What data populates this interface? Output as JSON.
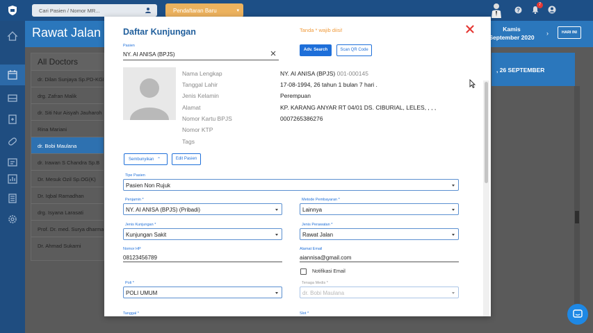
{
  "topbar": {
    "search_placeholder": "Cari Pasien / Nomor MR...",
    "register_button": "Pendaftaran Baru",
    "notification_count": "7"
  },
  "page": {
    "title": "Rawat Jalan",
    "date_line1": "Kamis",
    "date_line2": "September 2020",
    "today_button": "HARI INI",
    "schedule_header": ", 26 SEPTEMBER"
  },
  "doctors": {
    "header": "All Doctors",
    "items": [
      "dr. Dilan Sunjaya Sp.PD-KGH",
      "drg. Zafran Malik",
      "dr. Siti Nur Aisyah Jauharoh",
      "Rina Mariani",
      "dr. Bobi Maulana",
      "dr. Irawan S Chandra Sp.B",
      "Dr. Mesuk Ozil Sp.OG(K)",
      "Dr. Iqbal Ramadhan",
      "drg. Isyana Larasati",
      "Prof. Dr. med. Surya dharma",
      "Dr. Ahmad Sukarni"
    ]
  },
  "modal": {
    "title": "Daftar Kunjungan",
    "required_note": "Tanda * wajib diisi!",
    "pasien_label": "Pasien",
    "pasien_value": "NY. AI ANISA (BPJS)",
    "adv_search": "Adv. Search",
    "scan_qr": "Scan QR Code",
    "info_labels": [
      "Nama Lengkap",
      "Tanggal Lahir",
      "Jenis Kelamin",
      "Alamat",
      "Nomor Kartu BPJS",
      "Nomor KTP",
      "Tags"
    ],
    "info_values": {
      "nama": "NY. AI ANISA (BPJS)",
      "rm": "001-000145",
      "tanggal_lahir": "17-08-1994, 26 tahun 1 bulan 7 hari .",
      "jenis_kelamin": "Perempuan",
      "alamat": "KP. KARANG ANYAR RT 04/01 DS. CIBURIAL, LELES, , , ,",
      "bpjs": "0007265386276",
      "ktp": "",
      "tags": ""
    },
    "hide_button": "Sembunyikan",
    "edit_button": "Edit Pasien",
    "fields": {
      "tipe_pasien_label": "Tipe Pasien",
      "tipe_pasien_value": "Pasien Non Rujuk",
      "penjamin_label": "Penjamin *",
      "penjamin_value": "NY. AI ANISA (BPJS) (Pribadi)",
      "metode_label": "Metode Pembayaran *",
      "metode_value": "Lainnya",
      "jenis_kunjungan_label": "Jenis Kunjungan *",
      "jenis_kunjungan_value": "Kunjungan Sakit",
      "jenis_perawatan_label": "Jenis Perawatan *",
      "jenis_perawatan_value": "Rawat Jalan",
      "nomor_hp_label": "Nomor HP",
      "nomor_hp_value": "08123456789",
      "alamat_email_label": "Alamat Email",
      "alamat_email_value": "aiannisa@gmail.com",
      "notifikasi_email": "Notifikasi Email",
      "poli_label": "Poli *",
      "poli_value": "POLI UMUM",
      "tenaga_medis_label": "Tenaga Medis *",
      "tenaga_medis_value": "dr. Bobi Maulana",
      "tanggal_label": "Tanggal *",
      "slot_label": "Slot *"
    }
  },
  "colors": {
    "primary": "#1e6fd9",
    "header_blue": "#2b77bc",
    "title_blue": "#215f9c",
    "required_orange": "#f09a3a",
    "close_red": "#e53935",
    "register_orange": "#ecb25e"
  }
}
